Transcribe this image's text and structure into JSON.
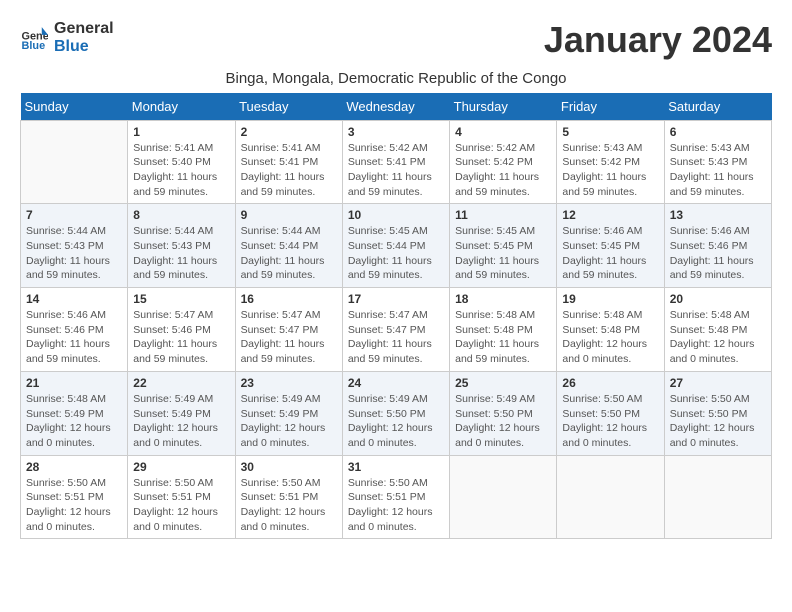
{
  "logo": {
    "line1": "General",
    "line2": "Blue"
  },
  "title": "January 2024",
  "subtitle": "Binga, Mongala, Democratic Republic of the Congo",
  "days_of_week": [
    "Sunday",
    "Monday",
    "Tuesday",
    "Wednesday",
    "Thursday",
    "Friday",
    "Saturday"
  ],
  "weeks": [
    [
      {
        "day": "",
        "info": ""
      },
      {
        "day": "1",
        "info": "Sunrise: 5:41 AM\nSunset: 5:40 PM\nDaylight: 11 hours\nand 59 minutes."
      },
      {
        "day": "2",
        "info": "Sunrise: 5:41 AM\nSunset: 5:41 PM\nDaylight: 11 hours\nand 59 minutes."
      },
      {
        "day": "3",
        "info": "Sunrise: 5:42 AM\nSunset: 5:41 PM\nDaylight: 11 hours\nand 59 minutes."
      },
      {
        "day": "4",
        "info": "Sunrise: 5:42 AM\nSunset: 5:42 PM\nDaylight: 11 hours\nand 59 minutes."
      },
      {
        "day": "5",
        "info": "Sunrise: 5:43 AM\nSunset: 5:42 PM\nDaylight: 11 hours\nand 59 minutes."
      },
      {
        "day": "6",
        "info": "Sunrise: 5:43 AM\nSunset: 5:43 PM\nDaylight: 11 hours\nand 59 minutes."
      }
    ],
    [
      {
        "day": "7",
        "info": "Sunrise: 5:44 AM\nSunset: 5:43 PM\nDaylight: 11 hours\nand 59 minutes."
      },
      {
        "day": "8",
        "info": "Sunrise: 5:44 AM\nSunset: 5:43 PM\nDaylight: 11 hours\nand 59 minutes."
      },
      {
        "day": "9",
        "info": "Sunrise: 5:44 AM\nSunset: 5:44 PM\nDaylight: 11 hours\nand 59 minutes."
      },
      {
        "day": "10",
        "info": "Sunrise: 5:45 AM\nSunset: 5:44 PM\nDaylight: 11 hours\nand 59 minutes."
      },
      {
        "day": "11",
        "info": "Sunrise: 5:45 AM\nSunset: 5:45 PM\nDaylight: 11 hours\nand 59 minutes."
      },
      {
        "day": "12",
        "info": "Sunrise: 5:46 AM\nSunset: 5:45 PM\nDaylight: 11 hours\nand 59 minutes."
      },
      {
        "day": "13",
        "info": "Sunrise: 5:46 AM\nSunset: 5:46 PM\nDaylight: 11 hours\nand 59 minutes."
      }
    ],
    [
      {
        "day": "14",
        "info": "Sunrise: 5:46 AM\nSunset: 5:46 PM\nDaylight: 11 hours\nand 59 minutes."
      },
      {
        "day": "15",
        "info": "Sunrise: 5:47 AM\nSunset: 5:46 PM\nDaylight: 11 hours\nand 59 minutes."
      },
      {
        "day": "16",
        "info": "Sunrise: 5:47 AM\nSunset: 5:47 PM\nDaylight: 11 hours\nand 59 minutes."
      },
      {
        "day": "17",
        "info": "Sunrise: 5:47 AM\nSunset: 5:47 PM\nDaylight: 11 hours\nand 59 minutes."
      },
      {
        "day": "18",
        "info": "Sunrise: 5:48 AM\nSunset: 5:48 PM\nDaylight: 11 hours\nand 59 minutes."
      },
      {
        "day": "19",
        "info": "Sunrise: 5:48 AM\nSunset: 5:48 PM\nDaylight: 12 hours\nand 0 minutes."
      },
      {
        "day": "20",
        "info": "Sunrise: 5:48 AM\nSunset: 5:48 PM\nDaylight: 12 hours\nand 0 minutes."
      }
    ],
    [
      {
        "day": "21",
        "info": "Sunrise: 5:48 AM\nSunset: 5:49 PM\nDaylight: 12 hours\nand 0 minutes."
      },
      {
        "day": "22",
        "info": "Sunrise: 5:49 AM\nSunset: 5:49 PM\nDaylight: 12 hours\nand 0 minutes."
      },
      {
        "day": "23",
        "info": "Sunrise: 5:49 AM\nSunset: 5:49 PM\nDaylight: 12 hours\nand 0 minutes."
      },
      {
        "day": "24",
        "info": "Sunrise: 5:49 AM\nSunset: 5:50 PM\nDaylight: 12 hours\nand 0 minutes."
      },
      {
        "day": "25",
        "info": "Sunrise: 5:49 AM\nSunset: 5:50 PM\nDaylight: 12 hours\nand 0 minutes."
      },
      {
        "day": "26",
        "info": "Sunrise: 5:50 AM\nSunset: 5:50 PM\nDaylight: 12 hours\nand 0 minutes."
      },
      {
        "day": "27",
        "info": "Sunrise: 5:50 AM\nSunset: 5:50 PM\nDaylight: 12 hours\nand 0 minutes."
      }
    ],
    [
      {
        "day": "28",
        "info": "Sunrise: 5:50 AM\nSunset: 5:51 PM\nDaylight: 12 hours\nand 0 minutes."
      },
      {
        "day": "29",
        "info": "Sunrise: 5:50 AM\nSunset: 5:51 PM\nDaylight: 12 hours\nand 0 minutes."
      },
      {
        "day": "30",
        "info": "Sunrise: 5:50 AM\nSunset: 5:51 PM\nDaylight: 12 hours\nand 0 minutes."
      },
      {
        "day": "31",
        "info": "Sunrise: 5:50 AM\nSunset: 5:51 PM\nDaylight: 12 hours\nand 0 minutes."
      },
      {
        "day": "",
        "info": ""
      },
      {
        "day": "",
        "info": ""
      },
      {
        "day": "",
        "info": ""
      }
    ]
  ]
}
